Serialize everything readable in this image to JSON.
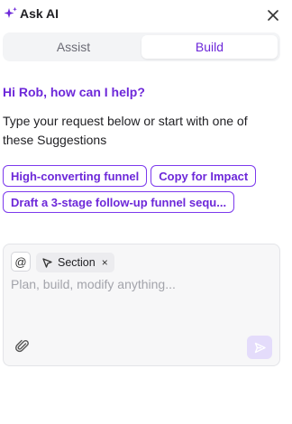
{
  "header": {
    "title": "Ask AI",
    "icon": "sparkle-icon",
    "close_icon": "close-icon"
  },
  "tabs": [
    {
      "label": "Assist",
      "active": false
    },
    {
      "label": "Build",
      "active": true
    }
  ],
  "greeting": "Hi Rob, how can I help?",
  "intro": "Type your request below or start with one of these Suggestions",
  "suggestions": [
    {
      "label": "High-converting funnel"
    },
    {
      "label": "Copy for Impact"
    },
    {
      "label": "Draft a 3-stage follow-up funnel sequ..."
    }
  ],
  "composer": {
    "mention_symbol": "@",
    "context_chip": {
      "label": "Section",
      "icon": "cursor-icon",
      "remove_symbol": "×"
    },
    "placeholder": "Plan, build, modify anything...",
    "value": "",
    "attach_icon": "paperclip-icon",
    "send_icon": "send-icon"
  },
  "colors": {
    "accent": "#6d28d9",
    "accent_border": "#7c3aed",
    "send_bg": "#e4dcfb",
    "composer_bg": "#f7f7f8",
    "tabs_bg": "#f3f4f6"
  }
}
